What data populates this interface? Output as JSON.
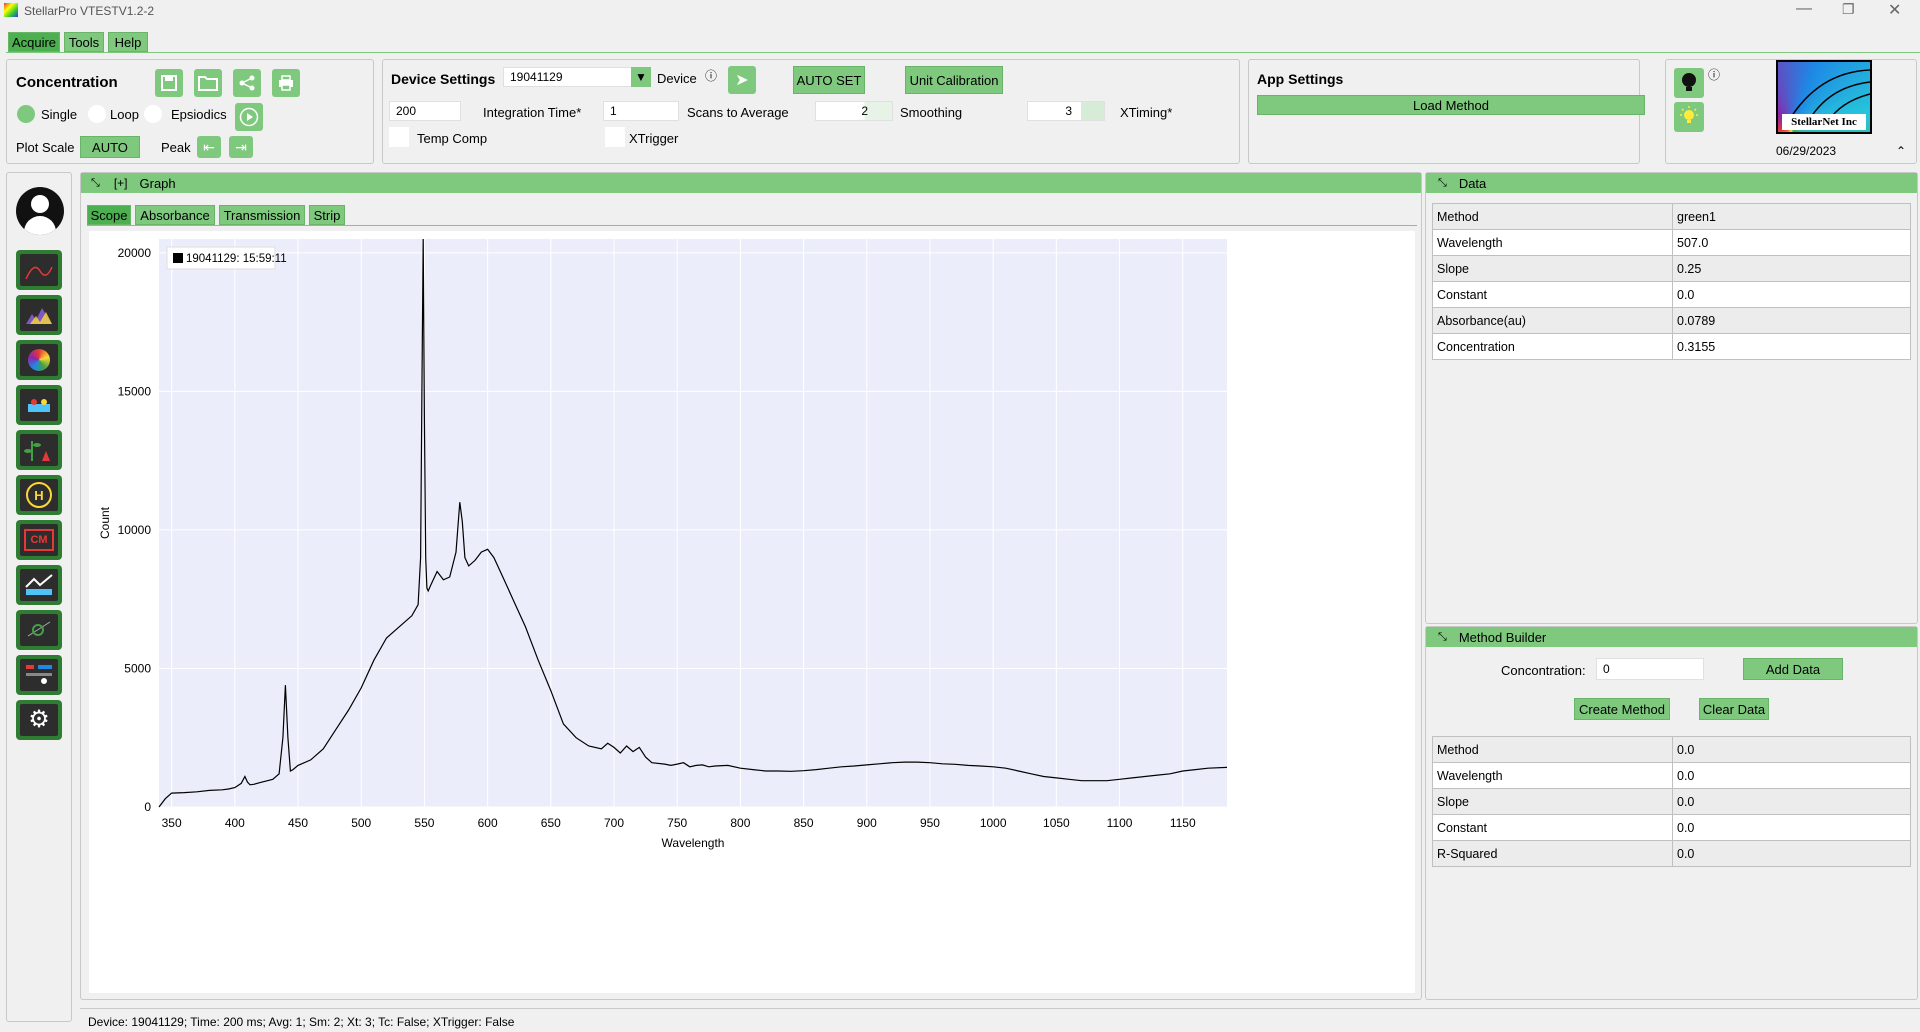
{
  "window": {
    "title": "StellarPro VTESTV1.2-2"
  },
  "menu": [
    "Acquire",
    "Tools",
    "Help"
  ],
  "concentration_panel": {
    "title": "Concentration",
    "modes": [
      "Single",
      "Loop",
      "Epsiodics"
    ],
    "selected_mode": "Single",
    "plot_scale_label": "Plot Scale",
    "plot_scale_value": "AUTO",
    "peak_label": "Peak"
  },
  "device_settings": {
    "title": "Device Settings",
    "device_id": "19041129",
    "device_label": "Device",
    "auto_set": "AUTO SET",
    "unit_calibration": "Unit Calibration",
    "integration_time_value": "200",
    "integration_time_label": "Integration Time*",
    "scans_value": "1",
    "scans_label": "Scans to Average",
    "smoothing_value": "2",
    "smoothing_label": "Smoothing",
    "xtiming_value": "3",
    "xtiming_label": "XTiming*",
    "temp_comp_label": "Temp Comp",
    "xtrigger_label": "XTrigger"
  },
  "app_settings": {
    "title": "App Settings",
    "load_method": "Load Method"
  },
  "logo": {
    "text": "StellarNet Inc",
    "date": "06/29/2023"
  },
  "graph_panel": {
    "expand": "[+]",
    "title": "Graph",
    "tabs": [
      "Scope",
      "Absorbance",
      "Transmission",
      "Strip"
    ],
    "active_tab": "Scope",
    "legend": "19041129:  15:59:11"
  },
  "chart_data": {
    "type": "line",
    "xlabel": "Wavelength",
    "ylabel": "Count",
    "xlim": [
      340,
      1185
    ],
    "ylim": [
      0,
      20500
    ],
    "xticks": [
      350,
      400,
      450,
      500,
      550,
      600,
      650,
      700,
      750,
      800,
      850,
      900,
      950,
      1000,
      1050,
      1100,
      1150
    ],
    "yticks": [
      0,
      5000,
      10000,
      15000,
      20000
    ],
    "grid": true,
    "legend_position": "top-left",
    "series": [
      {
        "name": "19041129:  15:59:11",
        "x": [
          340,
          345,
          350,
          360,
          370,
          380,
          390,
          395,
          400,
          405,
          408,
          410,
          412,
          415,
          420,
          430,
          435,
          438,
          440,
          442,
          444,
          446,
          450,
          460,
          470,
          480,
          490,
          500,
          510,
          520,
          530,
          540,
          545,
          547,
          548,
          549,
          550,
          551,
          552,
          553,
          555,
          560,
          565,
          570,
          575,
          578,
          580,
          582,
          585,
          590,
          595,
          600,
          605,
          610,
          615,
          620,
          630,
          640,
          650,
          660,
          670,
          680,
          690,
          695,
          700,
          705,
          710,
          715,
          720,
          725,
          730,
          740,
          745,
          750,
          755,
          760,
          765,
          770,
          775,
          780,
          790,
          800,
          810,
          820,
          830,
          840,
          850,
          860,
          870,
          880,
          890,
          900,
          910,
          920,
          930,
          940,
          950,
          960,
          970,
          980,
          990,
          1000,
          1010,
          1020,
          1030,
          1040,
          1050,
          1060,
          1070,
          1080,
          1090,
          1100,
          1110,
          1120,
          1130,
          1140,
          1150,
          1160,
          1170,
          1185
        ],
        "y": [
          0,
          300,
          500,
          520,
          550,
          600,
          620,
          650,
          700,
          850,
          1100,
          900,
          800,
          820,
          880,
          1000,
          1200,
          2500,
          4400,
          2500,
          1300,
          1350,
          1500,
          1700,
          2100,
          2800,
          3500,
          4300,
          5300,
          6100,
          6500,
          6900,
          7300,
          9000,
          15000,
          20500,
          14000,
          9000,
          7900,
          7800,
          8000,
          8500,
          8200,
          8300,
          9200,
          11000,
          10300,
          9000,
          8700,
          8900,
          9200,
          9300,
          9000,
          8500,
          8000,
          7500,
          6500,
          5300,
          4200,
          3000,
          2500,
          2200,
          2100,
          2300,
          2150,
          1950,
          2200,
          2000,
          2150,
          1800,
          1600,
          1550,
          1500,
          1550,
          1600,
          1450,
          1500,
          1520,
          1450,
          1480,
          1500,
          1400,
          1350,
          1300,
          1300,
          1290,
          1310,
          1350,
          1400,
          1450,
          1480,
          1520,
          1560,
          1600,
          1620,
          1620,
          1600,
          1560,
          1540,
          1500,
          1480,
          1450,
          1400,
          1300,
          1200,
          1100,
          1050,
          1000,
          950,
          950,
          950,
          1000,
          1050,
          1100,
          1150,
          1200,
          1300,
          1350,
          1400,
          1430
        ]
      }
    ]
  },
  "data_panel": {
    "title": "Data",
    "rows": [
      [
        "Method",
        "green1"
      ],
      [
        "Wavelength",
        "507.0"
      ],
      [
        "Slope",
        "0.25"
      ],
      [
        "Constant",
        "0.0"
      ],
      [
        "Absorbance(au)",
        "0.0789"
      ],
      [
        "Concentration",
        "0.3155"
      ]
    ]
  },
  "method_builder": {
    "title": "Method Builder",
    "concentration_label": "Concontration:",
    "concentration_value": "0",
    "add_data": "Add Data",
    "create_method": "Create Method",
    "clear_data": "Clear Data",
    "rows": [
      [
        "Method",
        "0.0"
      ],
      [
        "Wavelength",
        "0.0"
      ],
      [
        "Slope",
        "0.0"
      ],
      [
        "Constant",
        "0.0"
      ],
      [
        "R-Squared",
        "0.0"
      ]
    ]
  },
  "status_bar": "Device: 19041129; Time: 200 ms; Avg: 1; Sm: 2; Xt: 3; Tc: False; XTrigger: False",
  "colors": {
    "accent": "#7fc97f",
    "plot_bg": "#ebeefa",
    "line": "#000000"
  }
}
